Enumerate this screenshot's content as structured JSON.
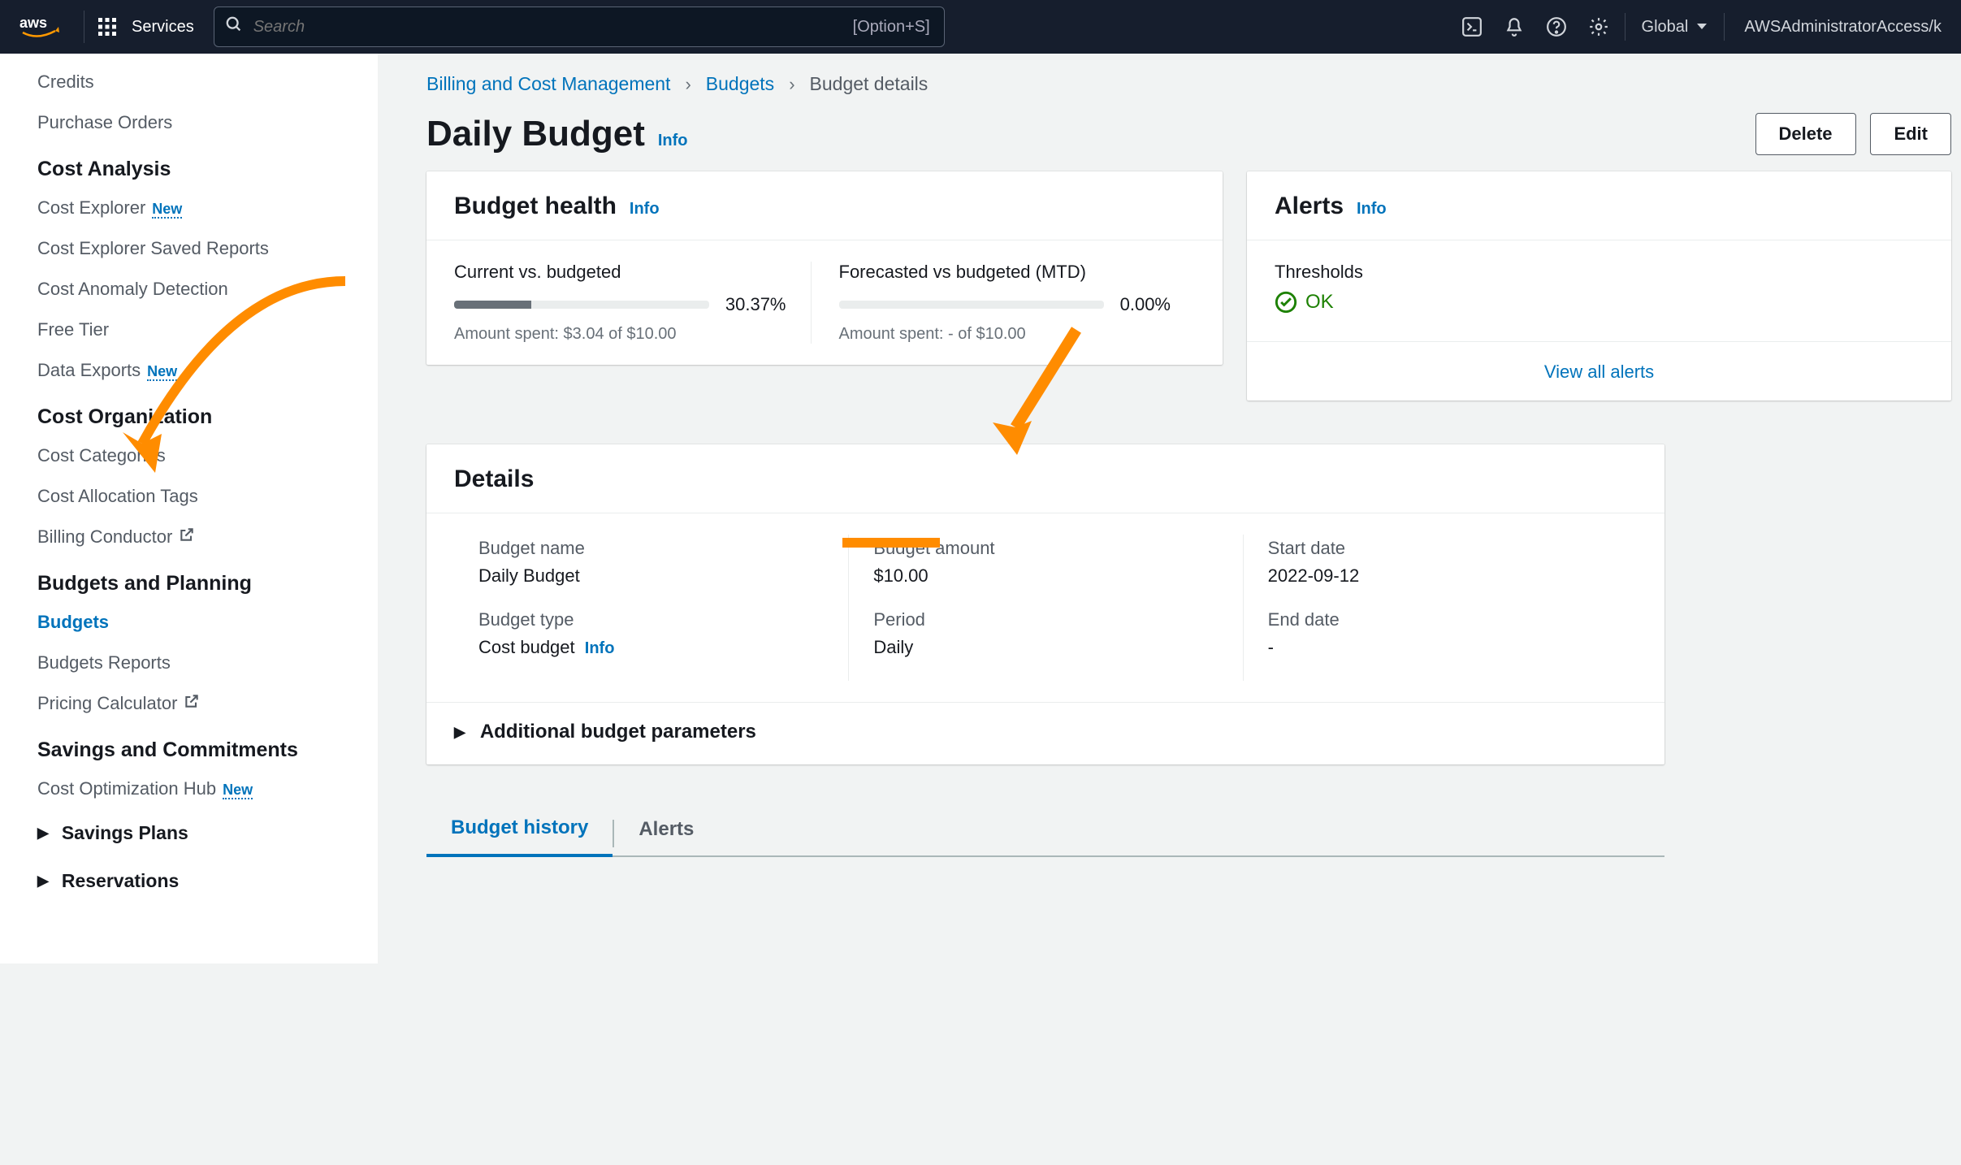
{
  "topnav": {
    "services_label": "Services",
    "search_placeholder": "Search",
    "search_shortcut": "[Option+S]",
    "region": "Global",
    "account": "AWSAdministratorAccess/k"
  },
  "sidebar": {
    "items_top": [
      {
        "label": "Credits"
      },
      {
        "label": "Purchase Orders"
      }
    ],
    "section_cost_analysis": "Cost Analysis",
    "items_cost_analysis": [
      {
        "label": "Cost Explorer",
        "badge": "New"
      },
      {
        "label": "Cost Explorer Saved Reports"
      },
      {
        "label": "Cost Anomaly Detection"
      },
      {
        "label": "Free Tier"
      },
      {
        "label": "Data Exports",
        "badge": "New"
      }
    ],
    "section_cost_org": "Cost Organization",
    "items_cost_org": [
      {
        "label": "Cost Categories"
      },
      {
        "label": "Cost Allocation Tags"
      },
      {
        "label": "Billing Conductor",
        "external": true
      }
    ],
    "section_budgets": "Budgets and Planning",
    "items_budgets": [
      {
        "label": "Budgets",
        "active": true
      },
      {
        "label": "Budgets Reports"
      },
      {
        "label": "Pricing Calculator",
        "external": true
      }
    ],
    "section_savings": "Savings and Commitments",
    "items_savings": [
      {
        "label": "Cost Optimization Hub",
        "badge": "New"
      }
    ],
    "caret_savings_plans": "Savings Plans",
    "caret_reservations": "Reservations"
  },
  "breadcrumb": {
    "root": "Billing and Cost Management",
    "mid": "Budgets",
    "leaf": "Budget details"
  },
  "title": {
    "text": "Daily Budget",
    "info": "Info",
    "delete": "Delete",
    "edit": "Edit"
  },
  "health": {
    "heading": "Budget health",
    "info": "Info",
    "current_label": "Current vs. budgeted",
    "current_pct_text": "30.37%",
    "current_pct_value": 30.37,
    "current_sub": "Amount spent: $3.04 of $10.00",
    "forecast_label": "Forecasted vs budgeted (MTD)",
    "forecast_pct_text": "0.00%",
    "forecast_pct_value": 0,
    "forecast_sub": "Amount spent: - of $10.00"
  },
  "alerts": {
    "heading": "Alerts",
    "info": "Info",
    "thresholds_label": "Thresholds",
    "ok_text": "OK",
    "view_all": "View all alerts"
  },
  "details": {
    "heading": "Details",
    "budget_name_label": "Budget name",
    "budget_name_value": "Daily Budget",
    "budget_type_label": "Budget type",
    "budget_type_value": "Cost budget",
    "budget_type_info": "Info",
    "budget_amount_label": "Budget amount",
    "budget_amount_value": "$10.00",
    "period_label": "Period",
    "period_value": "Daily",
    "start_date_label": "Start date",
    "start_date_value": "2022-09-12",
    "end_date_label": "End date",
    "end_date_value": "-",
    "expander": "Additional budget parameters"
  },
  "tabs": {
    "history": "Budget history",
    "alerts": "Alerts"
  }
}
